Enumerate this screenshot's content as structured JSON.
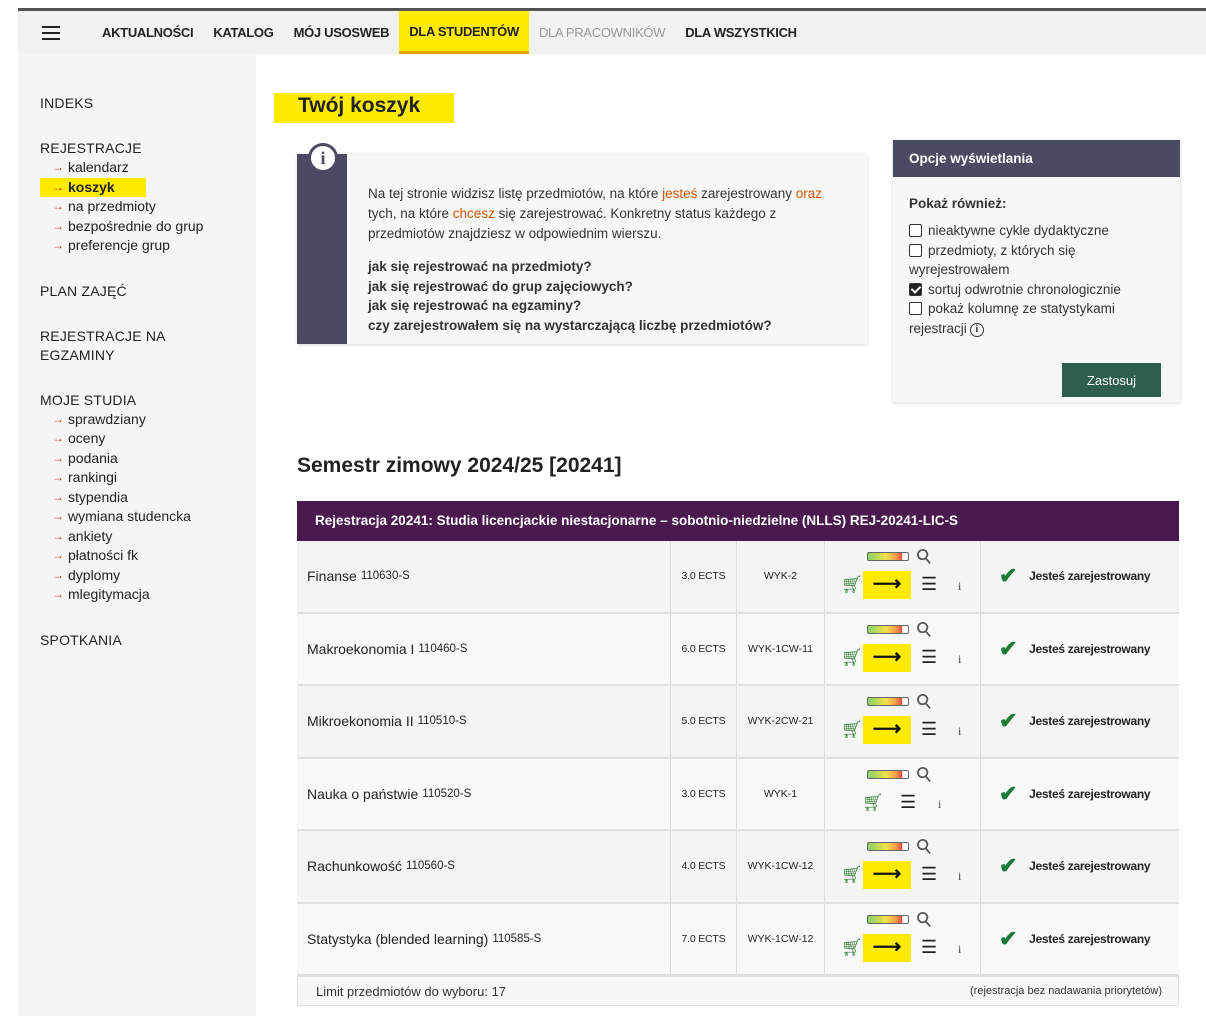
{
  "topnav": {
    "items": [
      {
        "label": "AKTUALNOŚCI"
      },
      {
        "label": "KATALOG"
      },
      {
        "label": "MÓJ USOSWEB"
      },
      {
        "label": "DLA STUDENTÓW"
      },
      {
        "label": "DLA PRACOWNIKÓW"
      },
      {
        "label": "DLA WSZYSTKICH"
      }
    ]
  },
  "sidebar": {
    "indeks": "INDEKS",
    "rejestracje": "REJESTRACJE",
    "rej_items": [
      "kalendarz",
      "koszyk",
      "na przedmioty",
      "bezpośrednie do grup",
      "preferencje grup"
    ],
    "plan": "PLAN ZAJĘĆ",
    "rej_egz_1": "REJESTRACJE NA",
    "rej_egz_2": "EGZAMINY",
    "moje": "MOJE STUDIA",
    "moje_items": [
      "sprawdziany",
      "oceny",
      "podania",
      "rankingi",
      "stypendia",
      "wymiana studencka",
      "ankiety",
      "płatności fk",
      "dyplomy",
      "mlegitymacja"
    ],
    "spotkania": "SPOTKANIA"
  },
  "page_title": "Twój koszyk",
  "info": {
    "p1": "Na tej stronie widzisz listę przedmiotów, na które ",
    "hl1": "jesteś",
    "p2": " zarejestrowany ",
    "hl2": "oraz",
    "p3": " tych, na które ",
    "hl3": "chcesz",
    "p4": " się zarejestrować. Konkretny status każdego z przedmiotów znajdziesz w odpowiednim wierszu.",
    "links": [
      "jak się rejestrować na przedmioty?",
      "jak się rejestrować do grup zajęciowych?",
      "jak się rejestrować na egzaminy?",
      "czy zarejestrowałem się na wystarczającą liczbę przedmiotów?"
    ]
  },
  "options": {
    "title": "Opcje wyświetlania",
    "label": "Pokaż również:",
    "opt1": "nieaktywne cykle dydaktyczne",
    "opt2": "przedmioty, z których się wyrejestrowałem",
    "opt3": "sortuj odwrotnie chronologicznie",
    "opt4": "pokaż kolumnę ze statystykami rejestracji",
    "opt1_checked": false,
    "opt2_checked": false,
    "opt3_checked": true,
    "opt4_checked": false,
    "apply": "Zastosuj"
  },
  "semester": "Semestr zimowy 2024/25 [20241]",
  "registration": {
    "header": "Rejestracja 20241: Studia licencjackie niestacjonarne – sobotnio-niedzielne (NLLS) REJ-20241-LIC-S",
    "rows": [
      {
        "name": "Finanse",
        "code": "110630-S",
        "ects": "3.0 ECTS",
        "groups": [
          "WYK-2"
        ],
        "status": "Jesteś zarejestrowany",
        "arrow": true
      },
      {
        "name": "Makroekonomia I",
        "code": "110460-S",
        "ects": "6.0 ECTS",
        "groups": [
          "WYK-1",
          "CW-11"
        ],
        "status": "Jesteś zarejestrowany",
        "arrow": true
      },
      {
        "name": "Mikroekonomia II",
        "code": "110510-S",
        "ects": "5.0 ECTS",
        "groups": [
          "WYK-2",
          "CW-21"
        ],
        "status": "Jesteś zarejestrowany",
        "arrow": true
      },
      {
        "name": "Nauka o państwie",
        "code": "110520-S",
        "ects": "3.0 ECTS",
        "groups": [
          "WYK-1"
        ],
        "status": "Jesteś zarejestrowany",
        "arrow": false
      },
      {
        "name": "Rachunkowość",
        "code": "110560-S",
        "ects": "4.0 ECTS",
        "groups": [
          "WYK-1",
          "CW-12"
        ],
        "status": "Jesteś zarejestrowany",
        "arrow": true
      },
      {
        "name": "Statystyka (blended learning)",
        "code": "110585-S",
        "ects": "7.0 ECTS",
        "groups": [
          "WYK-1",
          "CW-12"
        ],
        "status": "Jesteś zarejestrowany",
        "arrow": true
      }
    ],
    "limit": "Limit przedmiotów do wyboru: 17",
    "note": "(rejestracja bez nadawania priorytetów)"
  },
  "icons": {
    "menu": "hamburger-icon",
    "info": "info-icon",
    "cart": "cart-icon",
    "arrow": "arrow-right-icon",
    "list": "list-icon",
    "clip": "paperclip-icon",
    "check": "checkmark-icon"
  },
  "colors": {
    "highlight": "#ffeb00",
    "header_purple": "#4a1a4f",
    "panel_dark": "#4a4a62",
    "apply_green": "#2e5e4e",
    "check_green": "#1b7a3a"
  }
}
